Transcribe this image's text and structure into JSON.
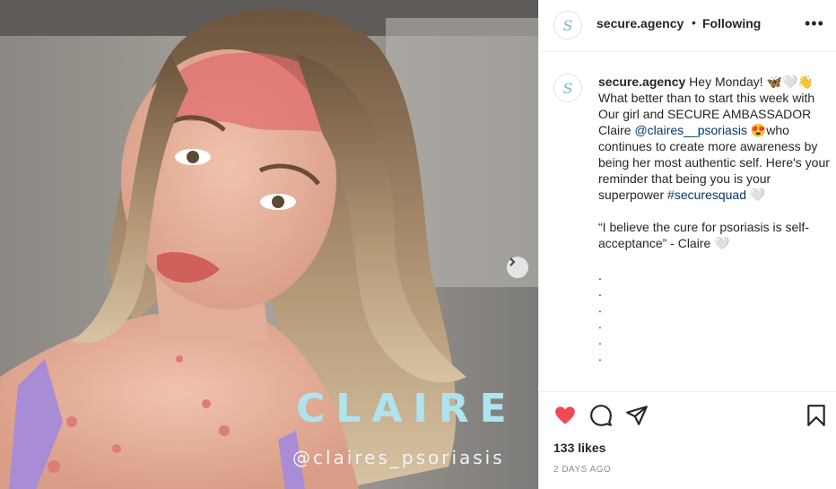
{
  "post": {
    "overlay_name": "CLAIRE",
    "overlay_handle": "@claires_psoriasis"
  },
  "header": {
    "username": "secure.agency",
    "separator": "•",
    "follow_status": "Following",
    "more": "•••",
    "avatar_letter": "S"
  },
  "caption": {
    "avatar_letter": "S",
    "username": "secure.agency",
    "line1": " Hey Monday! 🦋🤍👋",
    "line2": "What better than to start this week with Our girl and SECURE AMBASSADOR Claire ",
    "mention": "@claires__psoriasis",
    "line3": " 😍who continues to create more awareness by being her most authentic self. Here's your reminder that being you is your superpower ",
    "hashtag": "#securesquad",
    "heart1": " 🤍",
    "quote": "“I believe the cure for psoriasis is self-acceptance” - Claire",
    "heart2": " 🤍",
    "dots": [
      ".",
      ".",
      ".",
      ".",
      ".",
      "."
    ]
  },
  "footer": {
    "likes": "133 likes",
    "time": "2 DAYS AGO"
  },
  "colors": {
    "heart": "#ed4956",
    "link": "#00376b",
    "overlay_title": "#aee3ef"
  }
}
